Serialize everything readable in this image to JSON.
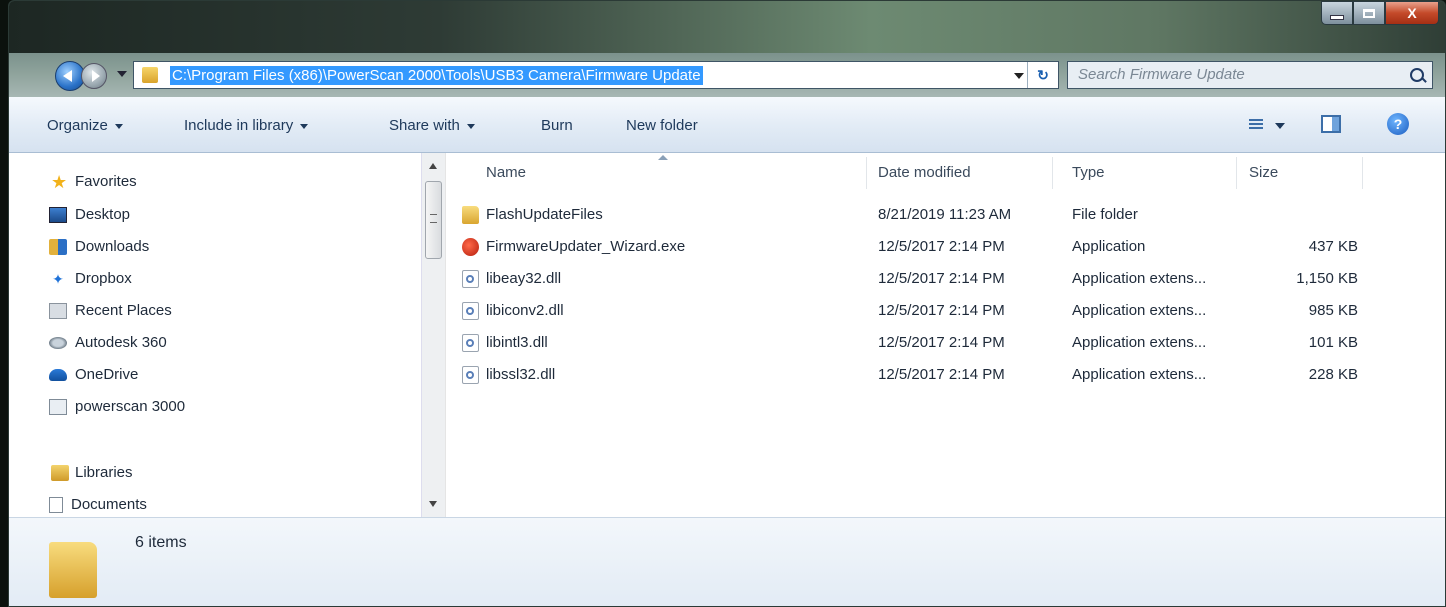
{
  "window": {
    "controls": {
      "minimize": "",
      "maximize": "",
      "close": "X"
    }
  },
  "address": {
    "path": "C:\\Program Files (x86)\\PowerScan 2000\\Tools\\USB3 Camera\\Firmware Update",
    "refresh_glyph": "↻"
  },
  "search": {
    "placeholder": "Search Firmware Update"
  },
  "toolbar": {
    "organize": "Organize",
    "include_in_library": "Include in library",
    "share_with": "Share with",
    "burn": "Burn",
    "new_folder": "New folder",
    "help_glyph": "?"
  },
  "nav": {
    "favorites": {
      "label": "Favorites",
      "items": [
        {
          "label": "Desktop",
          "icon": "desktop-icon"
        },
        {
          "label": "Downloads",
          "icon": "downloads-icon"
        },
        {
          "label": "Dropbox",
          "icon": "dropbox-icon"
        },
        {
          "label": "Recent Places",
          "icon": "recent-places-icon"
        },
        {
          "label": "Autodesk 360",
          "icon": "autodesk-icon"
        },
        {
          "label": "OneDrive",
          "icon": "onedrive-icon"
        },
        {
          "label": "powerscan 3000",
          "icon": "shortcut-icon"
        }
      ]
    },
    "libraries": {
      "label": "Libraries",
      "items": [
        {
          "label": "Documents",
          "icon": "documents-icon"
        }
      ]
    }
  },
  "columns": {
    "name": "Name",
    "date": "Date modified",
    "type": "Type",
    "size": "Size"
  },
  "files": [
    {
      "name": "FlashUpdateFiles",
      "date": "8/21/2019 11:23 AM",
      "type": "File folder",
      "size": "",
      "icon": "folder-icon"
    },
    {
      "name": "FirmwareUpdater_Wizard.exe",
      "date": "12/5/2017 2:14 PM",
      "type": "Application",
      "size": "437 KB",
      "icon": "exe-icon"
    },
    {
      "name": "libeay32.dll",
      "date": "12/5/2017 2:14 PM",
      "type": "Application extens...",
      "size": "1,150 KB",
      "icon": "dll-icon"
    },
    {
      "name": "libiconv2.dll",
      "date": "12/5/2017 2:14 PM",
      "type": "Application extens...",
      "size": "985 KB",
      "icon": "dll-icon"
    },
    {
      "name": "libintl3.dll",
      "date": "12/5/2017 2:14 PM",
      "type": "Application extens...",
      "size": "101 KB",
      "icon": "dll-icon"
    },
    {
      "name": "libssl32.dll",
      "date": "12/5/2017 2:14 PM",
      "type": "Application extens...",
      "size": "228 KB",
      "icon": "dll-icon"
    }
  ],
  "status": {
    "item_count": "6 items"
  },
  "colors": {
    "selection": "#3399ff",
    "toolbar_text": "#1e395b"
  }
}
